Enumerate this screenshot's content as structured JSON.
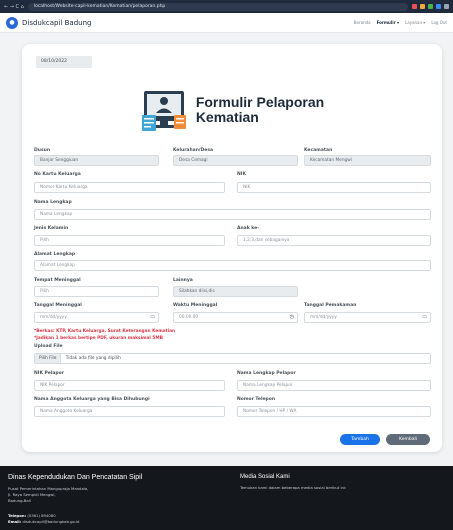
{
  "browser": {
    "url": "localhost/Website-capil-kematian/Kematian/pelaporan.php",
    "nav_glyphs": "← → C ⌂"
  },
  "navbar": {
    "brand": "Disdukcapil Badung",
    "menu": [
      "Beranda",
      "Formulir ▾",
      "Layanan ▾",
      "Log Out"
    ]
  },
  "form": {
    "date": "08/10/2022",
    "title_line1": "Formulir Pelaporan",
    "title_line2": "Kematian",
    "dusun_label": "Dusun",
    "dusun_value": "Banjar Senggiuan",
    "kelurahan_label": "Kelurahan/Desa",
    "kelurahan_value": "Desa Cemagi",
    "kecamatan_label": "Kecamatan",
    "kecamatan_value": "Kecamatan Mengwi",
    "nokk_label": "No Kartu Keluarga",
    "nokk_placeholder": "Nomor Kartu Keluarga",
    "nik_label": "NIK",
    "nik_placeholder": "NIK",
    "nama_label": "Nama Lengkap",
    "nama_placeholder": "Nama Lengkap",
    "jk_label": "Jenis Kelamin",
    "jk_value": "Pilih",
    "anak_label": "Anak ke-",
    "anak_placeholder": "1,2,3,dan sebagainya",
    "alamat_label": "Alamat Lengkap",
    "alamat_placeholder": "Alamat Lengkap",
    "tempat_label": "Tempat Meninggal",
    "tempat_value": "Pilih",
    "lainnya_label": "Lainnya",
    "lainnya_placeholder": "Silahkan diisi,dis",
    "tgl_meninggal_label": "Tanggal Meninggal",
    "tgl_meninggal_value": "mm/dd/yyyy",
    "waktu_label": "Waktu Meninggal",
    "waktu_value": "00.00.00",
    "tgl_makam_label": "Tanggal Pemakaman",
    "tgl_makam_value": "mm/dd/yyyy",
    "berkas_note1": "*Berkas: KTP, Kartu Keluarga, Surat Keterangan Kematian",
    "berkas_note2": "*Jadikan 1 berkas bertipe PDF, ukuran maksimal 5MB",
    "upload_label": "Upload File",
    "upload_button": "Pilih File",
    "upload_status": "Tidak ada file yang dipilih",
    "nik_pelapor_label": "NIK Pelapor",
    "nik_pelapor_placeholder": "NIK Pelapor",
    "nama_pelapor_label": "Nama Lengkap Pelapor",
    "nama_pelapor_placeholder": "Nama Lengkap Pelapor",
    "anggota_label": "Nama Anggota Keluarga yang Bisa Dihubungi",
    "anggota_placeholder": "Nama Anggota Keluarga",
    "telepon_label": "Nomor Telepon",
    "telepon_placeholder": "Nomor Telepon / HP / WA",
    "submit_label": "Tambah",
    "back_label": "Kembali"
  },
  "footer": {
    "title": "Dinas Kependudukan Dan Pencatatan Sipil",
    "address1": "Pusat Pemerintahan Mangupraja Mandala,",
    "address2": "Jl. Raya Sempidi Mengwi,",
    "address3": "Badung-Bali",
    "phone_label": "Telepon:",
    "phone_value": "(0361) 894080",
    "email_label": "Email:",
    "email_value": "disdukcapil@badungkab.go.id",
    "social_title": "Media Sosial Kami",
    "social_text": "Temukan kami dalam beberapa media sosial berikut ini:"
  },
  "colors": {
    "accent": "#1a73e8",
    "required_note": "#dc3545",
    "footer_bg": "#14171c"
  }
}
